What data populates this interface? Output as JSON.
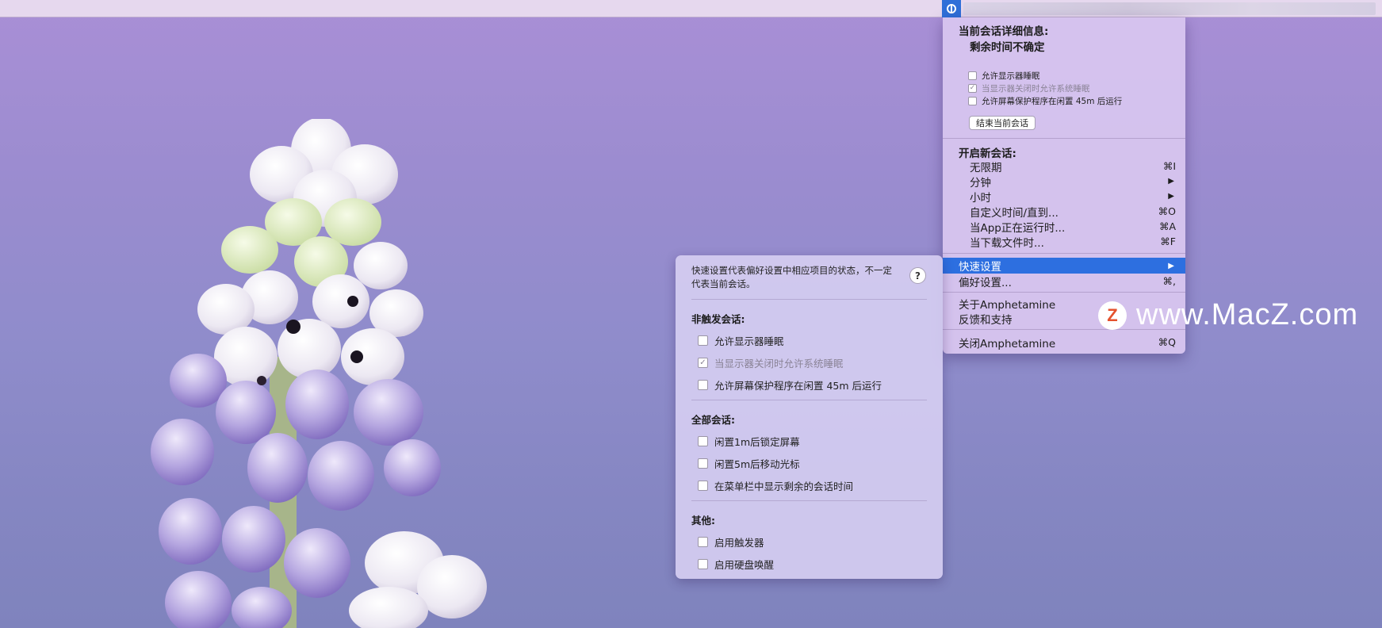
{
  "session": {
    "details_title": "当前会话详细信息:",
    "remaining": "剩余时间不确定",
    "options": [
      {
        "label": "允许显示器睡眠",
        "checked": false,
        "disabled": false
      },
      {
        "label": "当显示器关闭时允许系统睡眠",
        "checked": true,
        "disabled": true
      },
      {
        "label": "允许屏幕保护程序在闲置 45m 后运行",
        "checked": false,
        "disabled": false
      }
    ],
    "end_button": "结束当前会话"
  },
  "new_session": {
    "title": "开启新会话:",
    "items": [
      {
        "label": "无限期",
        "shortcut": "⌘I"
      },
      {
        "label": "分钟",
        "arrow": "▶"
      },
      {
        "label": "小时",
        "arrow": "▶"
      },
      {
        "label": "自定义时间/直到...",
        "shortcut": "⌘O"
      },
      {
        "label": "当App正在运行时...",
        "shortcut": "⌘A"
      },
      {
        "label": "当下载文件时...",
        "shortcut": "⌘F"
      }
    ]
  },
  "menu_items": {
    "quick_settings": {
      "label": "快速设置",
      "arrow": "▶"
    },
    "preferences": {
      "label": "偏好设置...",
      "shortcut": "⌘,"
    },
    "about": {
      "label": "关于Amphetamine"
    },
    "feedback": {
      "label": "反馈和支持"
    },
    "quit": {
      "label": "关闭Amphetamine",
      "shortcut": "⌘Q"
    }
  },
  "quick_panel": {
    "description": "快速设置代表偏好设置中相应项目的状态，不一定代表当前会话。",
    "help": "?",
    "sections": [
      {
        "title": "非触发会话:",
        "items": [
          {
            "label": "允许显示器睡眠",
            "checked": false,
            "disabled": false
          },
          {
            "label": "当显示器关闭时允许系统睡眠",
            "checked": true,
            "disabled": true
          },
          {
            "label": "允许屏幕保护程序在闲置 45m 后运行",
            "checked": false,
            "disabled": false
          }
        ]
      },
      {
        "title": "全部会话:",
        "items": [
          {
            "label": "闲置1m后锁定屏幕",
            "checked": false,
            "disabled": false
          },
          {
            "label": "闲置5m后移动光标",
            "checked": false,
            "disabled": false
          },
          {
            "label": "在菜单栏中显示剩余的会话时间",
            "checked": false,
            "disabled": false
          }
        ]
      },
      {
        "title": "其他:",
        "items": [
          {
            "label": "启用触发器",
            "checked": false,
            "disabled": false
          },
          {
            "label": "启用硬盘唤醒",
            "checked": false,
            "disabled": false
          }
        ]
      }
    ]
  },
  "watermark": {
    "badge": "Z",
    "text": "www.MacZ.com"
  },
  "colors": {
    "highlight": "#2d6fe0",
    "menu_bg": "#d6c4ee",
    "accent_logo": "#e4512d"
  },
  "checkmark": "✓"
}
